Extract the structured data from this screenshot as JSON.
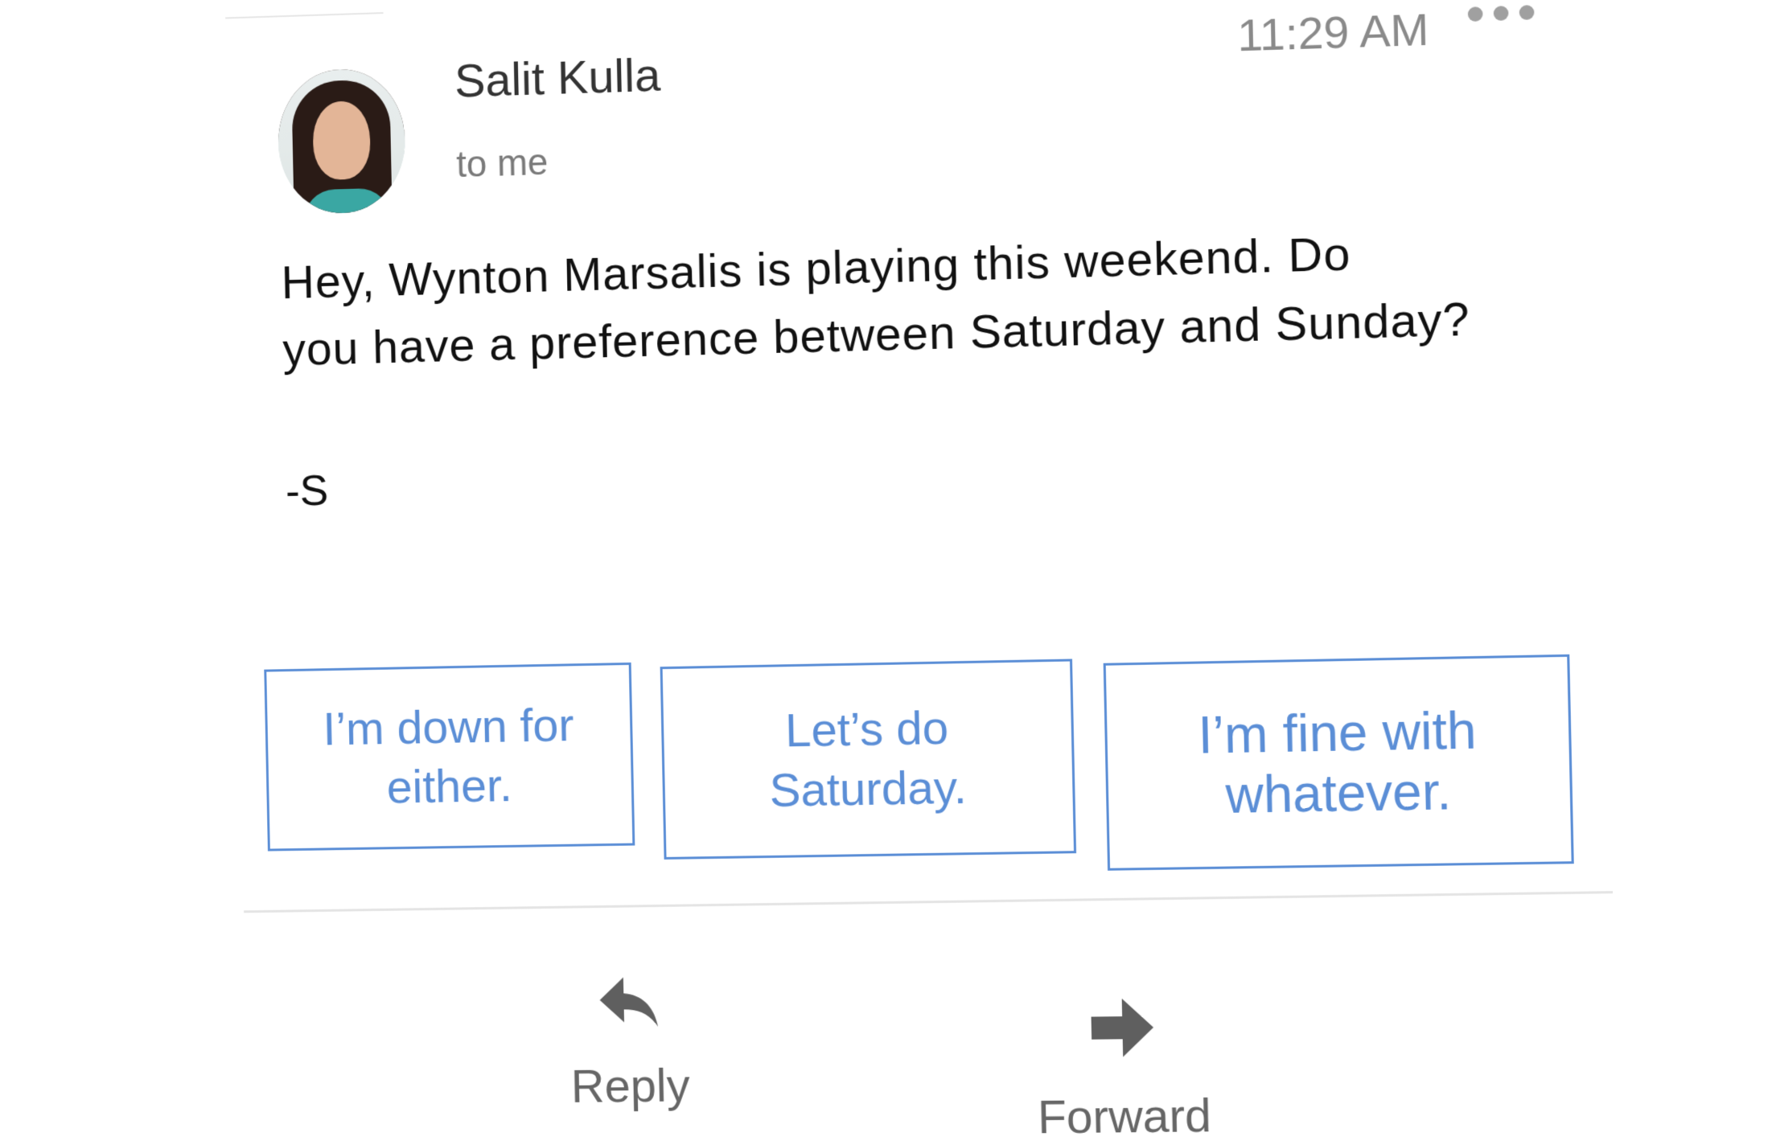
{
  "message": {
    "sender_name": "Salit Kulla",
    "recipient": "to me",
    "time": "11:29 AM",
    "body_line1": "Hey, Wynton Marsalis is playing this weekend. Do",
    "body_line2": "you have a preference between Saturday and Sunday?",
    "signature": "-S"
  },
  "smart_replies": [
    {
      "line1": "I’m down for",
      "line2": "either."
    },
    {
      "line1": "Let’s do",
      "line2": "Saturday."
    },
    {
      "line1": "I’m fine with",
      "line2": "whatever."
    }
  ],
  "actions": {
    "reply_label": "Reply",
    "forward_label": "Forward"
  },
  "icons": {
    "more": "more-horizontal-icon",
    "reply": "reply-arrow-icon",
    "forward": "forward-arrow-icon"
  },
  "colors": {
    "accent": "#5b8ed6",
    "icon": "#5f5f5f"
  }
}
